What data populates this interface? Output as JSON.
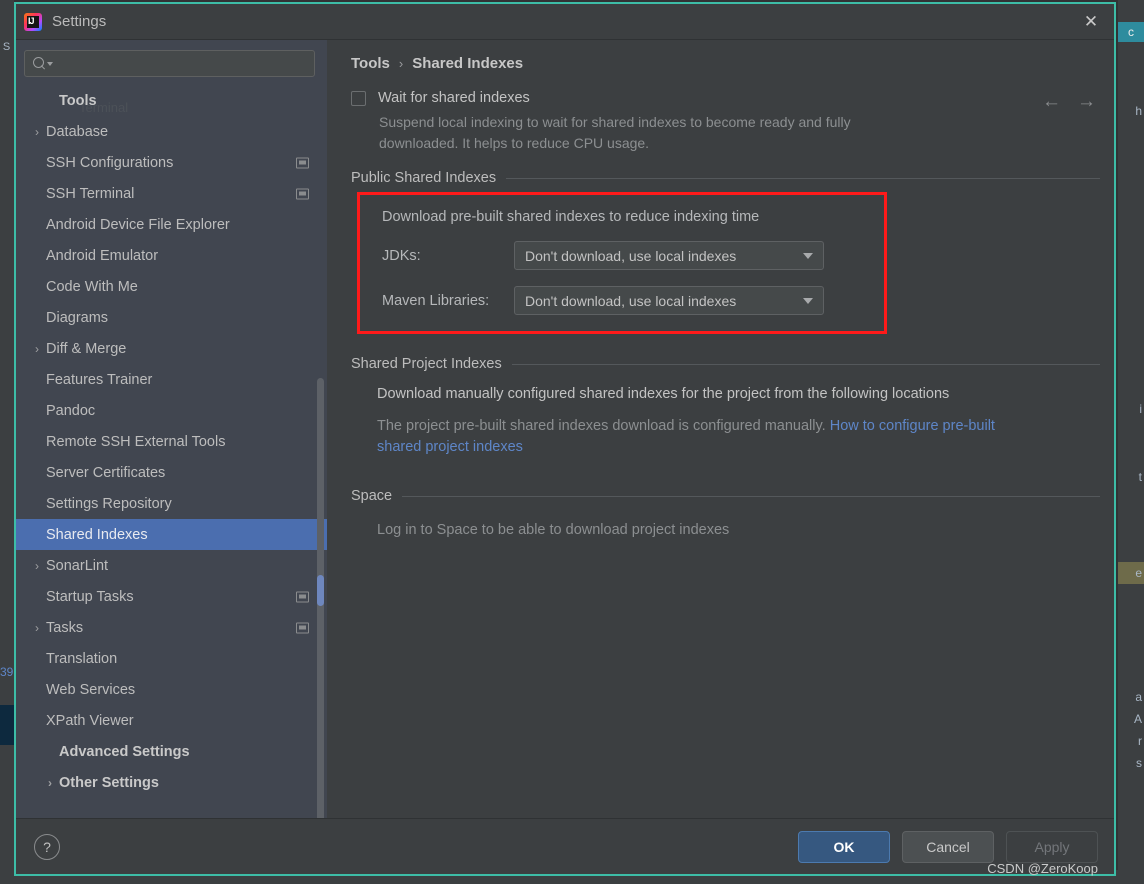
{
  "window": {
    "title": "Settings",
    "app_icon": "intellij-idea-icon",
    "close_label": "✕"
  },
  "search": {
    "value": "",
    "placeholder": "",
    "icon": "search-icon"
  },
  "sidebar": {
    "ghost_text": "Terminal",
    "items": [
      {
        "label": "Tools",
        "level": 0,
        "group": true,
        "arrow": "",
        "badge": false,
        "selected": false
      },
      {
        "label": "Database",
        "level": 1,
        "group": false,
        "arrow": "›",
        "badge": false,
        "selected": false
      },
      {
        "label": "SSH Configurations",
        "level": 1,
        "group": false,
        "arrow": "",
        "badge": true,
        "selected": false
      },
      {
        "label": "SSH Terminal",
        "level": 1,
        "group": false,
        "arrow": "",
        "badge": true,
        "selected": false
      },
      {
        "label": "Android Device File Explorer",
        "level": 1,
        "group": false,
        "arrow": "",
        "badge": false,
        "selected": false
      },
      {
        "label": "Android Emulator",
        "level": 1,
        "group": false,
        "arrow": "",
        "badge": false,
        "selected": false
      },
      {
        "label": "Code With Me",
        "level": 1,
        "group": false,
        "arrow": "",
        "badge": false,
        "selected": false
      },
      {
        "label": "Diagrams",
        "level": 1,
        "group": false,
        "arrow": "",
        "badge": false,
        "selected": false
      },
      {
        "label": "Diff & Merge",
        "level": 1,
        "group": false,
        "arrow": "›",
        "badge": false,
        "selected": false
      },
      {
        "label": "Features Trainer",
        "level": 1,
        "group": false,
        "arrow": "",
        "badge": false,
        "selected": false
      },
      {
        "label": "Pandoc",
        "level": 1,
        "group": false,
        "arrow": "",
        "badge": false,
        "selected": false
      },
      {
        "label": "Remote SSH External Tools",
        "level": 1,
        "group": false,
        "arrow": "",
        "badge": false,
        "selected": false
      },
      {
        "label": "Server Certificates",
        "level": 1,
        "group": false,
        "arrow": "",
        "badge": false,
        "selected": false
      },
      {
        "label": "Settings Repository",
        "level": 1,
        "group": false,
        "arrow": "",
        "badge": false,
        "selected": false
      },
      {
        "label": "Shared Indexes",
        "level": 1,
        "group": false,
        "arrow": "",
        "badge": false,
        "selected": true
      },
      {
        "label": "SonarLint",
        "level": 1,
        "group": false,
        "arrow": "›",
        "badge": false,
        "selected": false
      },
      {
        "label": "Startup Tasks",
        "level": 1,
        "group": false,
        "arrow": "",
        "badge": true,
        "selected": false
      },
      {
        "label": "Tasks",
        "level": 1,
        "group": false,
        "arrow": "›",
        "badge": true,
        "selected": false
      },
      {
        "label": "Translation",
        "level": 1,
        "group": false,
        "arrow": "",
        "badge": false,
        "selected": false
      },
      {
        "label": "Web Services",
        "level": 1,
        "group": false,
        "arrow": "",
        "badge": false,
        "selected": false
      },
      {
        "label": "XPath Viewer",
        "level": 1,
        "group": false,
        "arrow": "",
        "badge": false,
        "selected": false
      },
      {
        "label": "Advanced Settings",
        "level": 0,
        "group": true,
        "arrow": "",
        "badge": false,
        "selected": false
      },
      {
        "label": "Other Settings",
        "level": 0,
        "group": true,
        "arrow": "›",
        "badge": false,
        "selected": false
      }
    ]
  },
  "breadcrumb": {
    "root": "Tools",
    "separator": "›",
    "current": "Shared Indexes"
  },
  "nav": {
    "back": "←",
    "forward": "→"
  },
  "main": {
    "wait_checkbox": {
      "label": "Wait for shared indexes",
      "checked": false,
      "description": "Suspend local indexing to wait for shared indexes to become ready and fully downloaded. It helps to reduce CPU usage."
    },
    "public_section": {
      "title": "Public Shared Indexes",
      "highlight_color": "#FF1A1A",
      "intro": "Download pre-built shared indexes to reduce indexing time",
      "fields": [
        {
          "label": "JDKs:",
          "value": "Don't download, use local indexes"
        },
        {
          "label": "Maven Libraries:",
          "value": "Don't download, use local indexes"
        }
      ]
    },
    "project_section": {
      "title": "Shared Project Indexes",
      "line1": "Download manually configured shared indexes for the project from the following locations",
      "line2_prefix": "The project pre-built shared indexes download is configured manually. ",
      "link_text": "How to configure pre-built shared project indexes",
      "link_color": "#5E86C8"
    },
    "space_section": {
      "title": "Space",
      "note": "Log in to Space to be able to download project indexes"
    }
  },
  "footer": {
    "help_label": "?",
    "ok_label": "OK",
    "cancel_label": "Cancel",
    "apply_label": "Apply",
    "apply_enabled": false
  },
  "watermark": "CSDN @ZeroKoop",
  "backdrop": {
    "left_tab": "S",
    "left_line_number": "39",
    "right_chip": "c",
    "right_fragments": [
      "h",
      "i",
      "t",
      "e",
      "a",
      "A",
      "r",
      "s"
    ]
  }
}
